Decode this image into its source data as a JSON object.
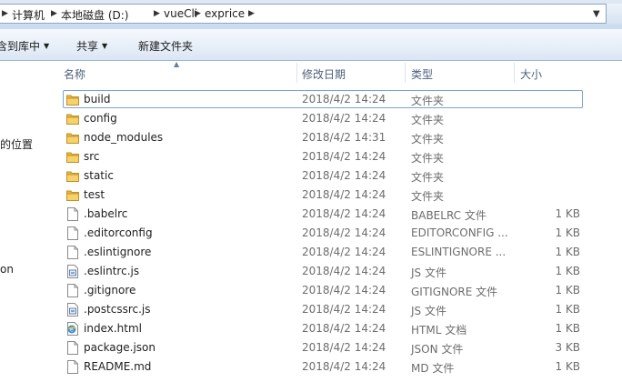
{
  "address": {
    "crumbs": [
      "计算机",
      "本地磁盘 (D:)",
      "vueCli",
      "exprice"
    ]
  },
  "toolbar": {
    "include_library": "含到库中",
    "share": "共享",
    "new_folder": "新建文件夹"
  },
  "nav": {
    "items": [
      "的位置",
      "on"
    ]
  },
  "columns": {
    "name": "名称",
    "date": "修改日期",
    "type": "类型",
    "size": "大小"
  },
  "files": [
    {
      "name": "build",
      "date": "2018/4/2 14:24",
      "type": "文件夹",
      "size": "",
      "icon": "folder-icon"
    },
    {
      "name": "config",
      "date": "2018/4/2 14:24",
      "type": "文件夹",
      "size": "",
      "icon": "folder-icon"
    },
    {
      "name": "node_modules",
      "date": "2018/4/2 14:31",
      "type": "文件夹",
      "size": "",
      "icon": "folder-icon"
    },
    {
      "name": "src",
      "date": "2018/4/2 14:24",
      "type": "文件夹",
      "size": "",
      "icon": "folder-icon"
    },
    {
      "name": "static",
      "date": "2018/4/2 14:24",
      "type": "文件夹",
      "size": "",
      "icon": "folder-icon"
    },
    {
      "name": "test",
      "date": "2018/4/2 14:24",
      "type": "文件夹",
      "size": "",
      "icon": "folder-icon"
    },
    {
      "name": ".babelrc",
      "date": "2018/4/2 14:24",
      "type": "BABELRC 文件",
      "size": "1 KB",
      "icon": "file-icon"
    },
    {
      "name": ".editorconfig",
      "date": "2018/4/2 14:24",
      "type": "EDITORCONFIG ...",
      "size": "1 KB",
      "icon": "file-icon"
    },
    {
      "name": ".eslintignore",
      "date": "2018/4/2 14:24",
      "type": "ESLINTIGNORE ...",
      "size": "1 KB",
      "icon": "file-icon"
    },
    {
      "name": ".eslintrc.js",
      "date": "2018/4/2 14:24",
      "type": "JS 文件",
      "size": "1 KB",
      "icon": "js-file-icon"
    },
    {
      "name": ".gitignore",
      "date": "2018/4/2 14:24",
      "type": "GITIGNORE 文件",
      "size": "1 KB",
      "icon": "file-icon"
    },
    {
      "name": ".postcssrc.js",
      "date": "2018/4/2 14:24",
      "type": "JS 文件",
      "size": "1 KB",
      "icon": "js-file-icon"
    },
    {
      "name": "index.html",
      "date": "2018/4/2 14:24",
      "type": "HTML 文档",
      "size": "1 KB",
      "icon": "html-file-icon"
    },
    {
      "name": "package.json",
      "date": "2018/4/2 14:24",
      "type": "JSON 文件",
      "size": "3 KB",
      "icon": "file-icon"
    },
    {
      "name": "README.md",
      "date": "2018/4/2 14:24",
      "type": "MD 文件",
      "size": "1 KB",
      "icon": "file-icon"
    }
  ]
}
